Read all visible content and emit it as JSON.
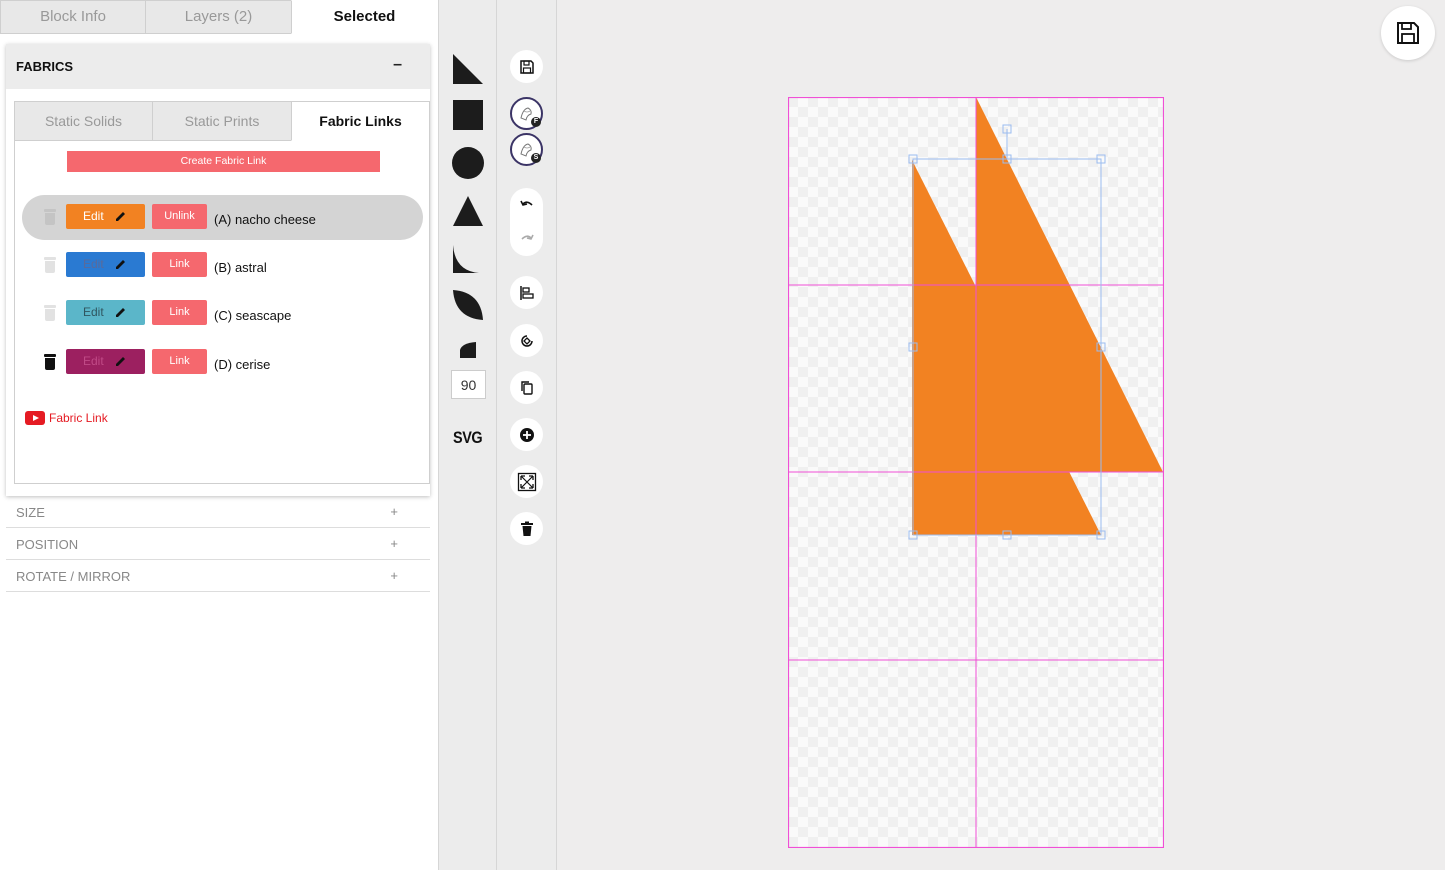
{
  "tabs": {
    "block_info": "Block Info",
    "layers": "Layers (2)",
    "selected": "Selected"
  },
  "fabrics": {
    "title": "FABRICS",
    "collapse_symbol": "–",
    "subtabs": {
      "static_solids": "Static Solids",
      "static_prints": "Static Prints",
      "fabric_links": "Fabric Links"
    },
    "create_label": "Create Fabric Link",
    "items": [
      {
        "name": "(A) nacho cheese",
        "edit_label": "Edit",
        "action_label": "Unlink",
        "color": "#f28222",
        "selected": true
      },
      {
        "name": "(B) astral",
        "edit_label": "Edit",
        "action_label": "Link",
        "color": "#2a7ad2",
        "selected": false
      },
      {
        "name": "(C) seascape",
        "edit_label": "Edit",
        "action_label": "Link",
        "color": "#5bb6c9",
        "selected": false
      },
      {
        "name": "(D) cerise",
        "edit_label": "Edit",
        "action_label": "Link",
        "color": "#9c2060",
        "selected": false
      }
    ],
    "video_link": "Fabric Link"
  },
  "accordion": {
    "size": "SIZE",
    "position": "POSITION",
    "rotate_mirror": "ROTATE / MIRROR",
    "expand_symbol": "+"
  },
  "shapes": {
    "angle_value": "90",
    "svg_label": "SVG"
  },
  "tools": {
    "fabric_badge_f": "F",
    "fabric_badge_s": "S"
  },
  "canvas": {
    "shape_fill": "#f28222",
    "grid_color": "#f04fd6",
    "selection_color": "#9bbcf0"
  }
}
